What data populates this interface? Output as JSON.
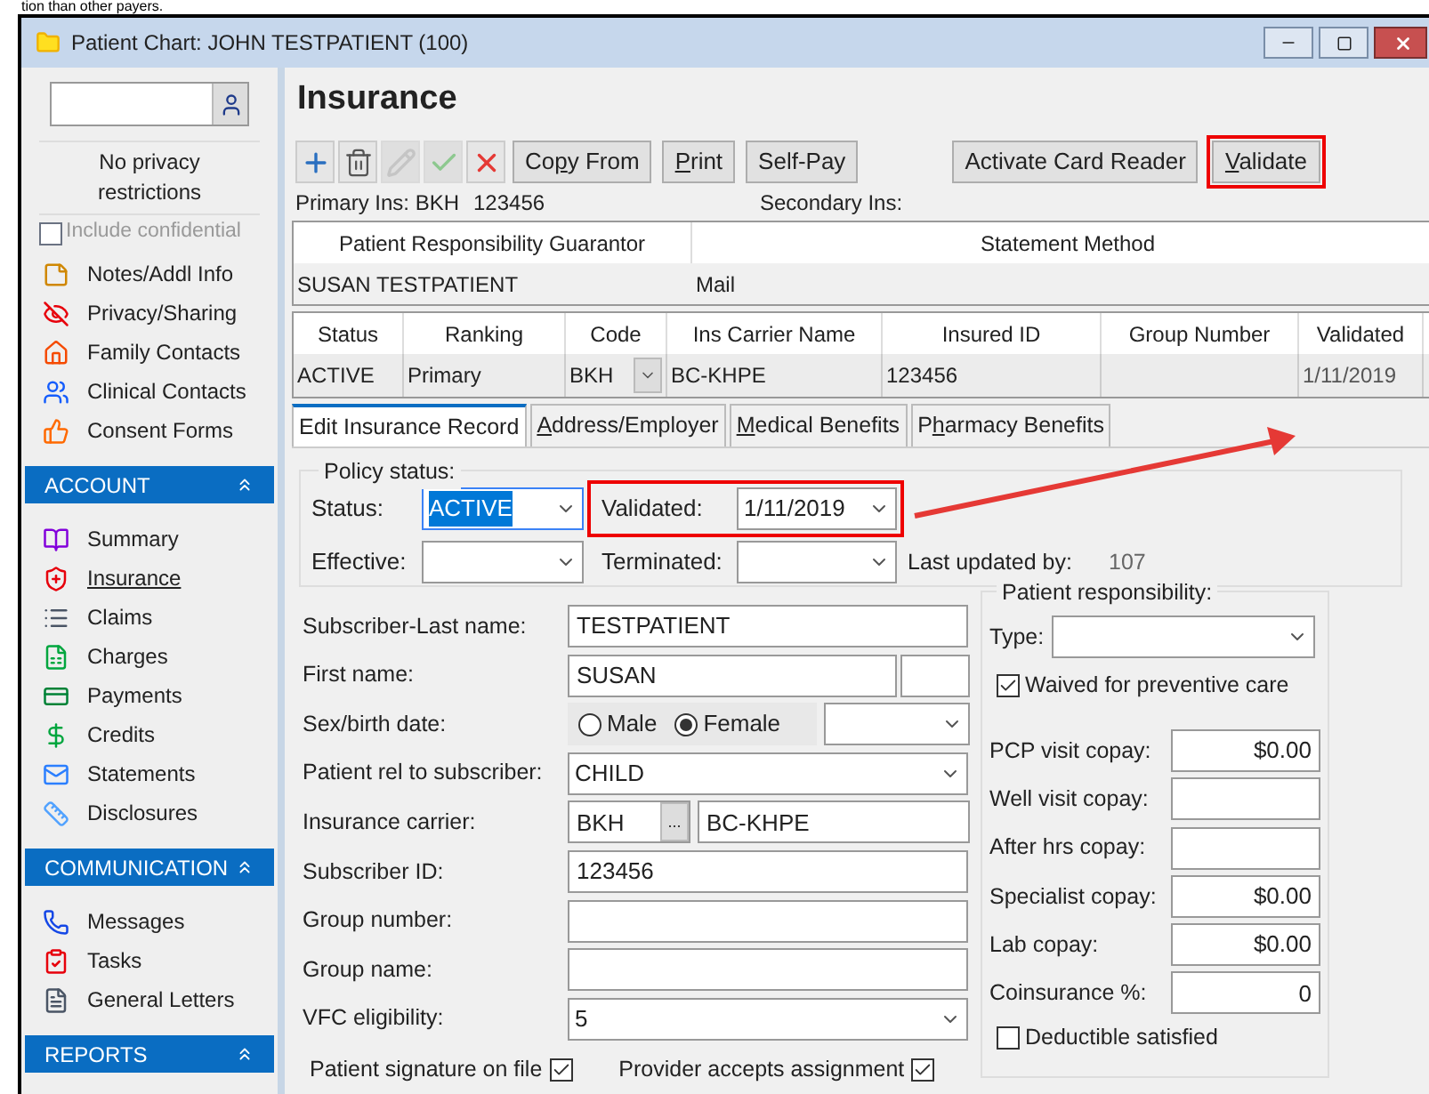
{
  "caption_fragment": "tion than other payers.",
  "window": {
    "title": "Patient Chart: JOHN TESTPATIENT (100)"
  },
  "sidebar": {
    "privacy_text": "No privacy restrictions",
    "include_confidential": {
      "label": "Include confidential",
      "checked": false,
      "disabled": true
    },
    "items": [
      {
        "label": "Notes/Addl Info",
        "selected": false
      },
      {
        "label": "Privacy/Sharing",
        "selected": false
      },
      {
        "label": "Family Contacts",
        "selected": false
      },
      {
        "label": "Clinical Contacts",
        "selected": false
      },
      {
        "label": "Consent Forms",
        "selected": false
      }
    ],
    "sections": [
      {
        "title": "ACCOUNT",
        "expanded": true,
        "items": [
          {
            "label": "Summary",
            "selected": false
          },
          {
            "label": "Insurance",
            "selected": true
          },
          {
            "label": "Claims",
            "selected": false
          },
          {
            "label": "Charges",
            "selected": false
          },
          {
            "label": "Payments",
            "selected": false
          },
          {
            "label": "Credits",
            "selected": false
          },
          {
            "label": "Statements",
            "selected": false
          },
          {
            "label": "Disclosures",
            "selected": false
          }
        ]
      },
      {
        "title": "COMMUNICATION",
        "expanded": true,
        "items": [
          {
            "label": "Messages",
            "selected": false
          },
          {
            "label": "Tasks",
            "selected": false
          },
          {
            "label": "General Letters",
            "selected": false
          }
        ]
      },
      {
        "title": "REPORTS",
        "expanded": true
      }
    ]
  },
  "page_title": "Insurance",
  "toolbar": {
    "icon_buttons": [
      {
        "kind": "add",
        "disabled": false
      },
      {
        "kind": "delete",
        "disabled": false
      },
      {
        "kind": "edit",
        "disabled": true
      },
      {
        "kind": "save",
        "disabled": true
      },
      {
        "kind": "cancel",
        "disabled": false
      }
    ],
    "buttons": [
      {
        "label_parts": [
          {
            "text": "Co",
            "underlined": false
          },
          {
            "text": "p",
            "underlined": true
          },
          {
            "text": "y From",
            "underlined": false
          }
        ]
      },
      {
        "label_parts": [
          {
            "text": "P",
            "underlined": true
          },
          {
            "text": "rint",
            "underlined": false
          }
        ]
      },
      {
        "label_parts": [
          {
            "text": "Self-Pay",
            "underlined": false
          }
        ]
      }
    ],
    "right_buttons": [
      {
        "label_parts": [
          {
            "text": "Activate Card Reader",
            "underlined": false
          }
        ],
        "highlighted": false
      },
      {
        "label_parts": [
          {
            "text": "V",
            "underlined": true
          },
          {
            "text": "alidate",
            "underlined": false
          }
        ],
        "highlighted": true
      }
    ]
  },
  "primary_ins": {
    "label": "Primary Ins: BKH",
    "id": "123456"
  },
  "secondary_ins": {
    "label": "Secondary Ins:"
  },
  "guarantor_table": {
    "columns": [
      "Patient Responsibility Guarantor",
      "Statement Method"
    ],
    "rows": [
      [
        "SUSAN TESTPATIENT",
        "Mail"
      ]
    ]
  },
  "insurance_table": {
    "columns": [
      "Status",
      "Ranking",
      "Code",
      "Ins Carrier Name",
      "Insured ID",
      "Group Number",
      "Validated"
    ],
    "rows": [
      {
        "selected": true,
        "cells": [
          "ACTIVE",
          "Primary",
          "BKH",
          "BC-KHPE",
          "123456",
          null,
          "1/11/2019"
        ]
      }
    ]
  },
  "tabs": [
    {
      "label_parts": [
        {
          "text": "Edit Insurance Record",
          "underlined": false
        }
      ],
      "selected": true
    },
    {
      "label_parts": [
        {
          "text": "A",
          "underlined": true
        },
        {
          "text": "ddress/Employer",
          "underlined": false
        }
      ],
      "selected": false
    },
    {
      "label_parts": [
        {
          "text": "M",
          "underlined": true
        },
        {
          "text": "edical Benefits",
          "underlined": false
        }
      ],
      "selected": false
    },
    {
      "label_parts": [
        {
          "text": "P",
          "underlined": false
        },
        {
          "text": "h",
          "underlined": true
        },
        {
          "text": "armacy Benefits",
          "underlined": false
        }
      ],
      "selected": false
    }
  ],
  "policy_status": {
    "legend": "Policy status:",
    "status": {
      "label": "Status:",
      "value": "ACTIVE",
      "focused": true
    },
    "validated": {
      "label": "Validated:",
      "value": "1/11/2019",
      "highlighted": true
    },
    "effective": {
      "label": "Effective:"
    },
    "terminated": {
      "label": "Terminated:"
    },
    "last_updated": {
      "label": "Last updated by:",
      "value": "107"
    }
  },
  "subscriber_fields": [
    {
      "kind": "text",
      "label": "Subscriber-Last name:",
      "value": "TESTPATIENT"
    },
    {
      "kind": "name",
      "label": "First name:",
      "value": "SUSAN"
    },
    {
      "kind": "sex",
      "label": "Sex/birth date:",
      "options": [
        {
          "label": "Male",
          "selected": false
        },
        {
          "label": "Female",
          "selected": true
        }
      ]
    },
    {
      "kind": "select",
      "label": "Patient rel to subscriber:",
      "value": "CHILD"
    },
    {
      "kind": "carrier",
      "label": "Insurance carrier:",
      "code": "BKH",
      "browse": "...",
      "value": "BC-KHPE"
    },
    {
      "kind": "text",
      "label": "Subscriber ID:",
      "value": "123456"
    },
    {
      "kind": "text",
      "label": "Group number:"
    },
    {
      "kind": "text",
      "label": "Group name:"
    },
    {
      "kind": "select",
      "label": "VFC eligibility:",
      "value": "5"
    }
  ],
  "bottom_checks": [
    {
      "label": "Patient signature on file",
      "checked": true
    },
    {
      "label": "Provider accepts assignment",
      "checked": true
    }
  ],
  "patient_responsibility": {
    "legend": "Patient responsibility:",
    "type_label": "Type:",
    "waived": {
      "label": "Waived for preventive care",
      "checked": true
    },
    "copays": [
      {
        "label": "PCP visit copay:",
        "value": "$0.00"
      },
      {
        "label": "Well visit copay:"
      },
      {
        "label": "After hrs copay:"
      },
      {
        "label": "Specialist copay:",
        "value": "$0.00"
      },
      {
        "label": "Lab copay:",
        "value": "$0.00"
      },
      {
        "label": "Coinsurance %:",
        "value": "0"
      }
    ],
    "deductible": {
      "label": "Deductible satisfied",
      "checked": false
    }
  }
}
